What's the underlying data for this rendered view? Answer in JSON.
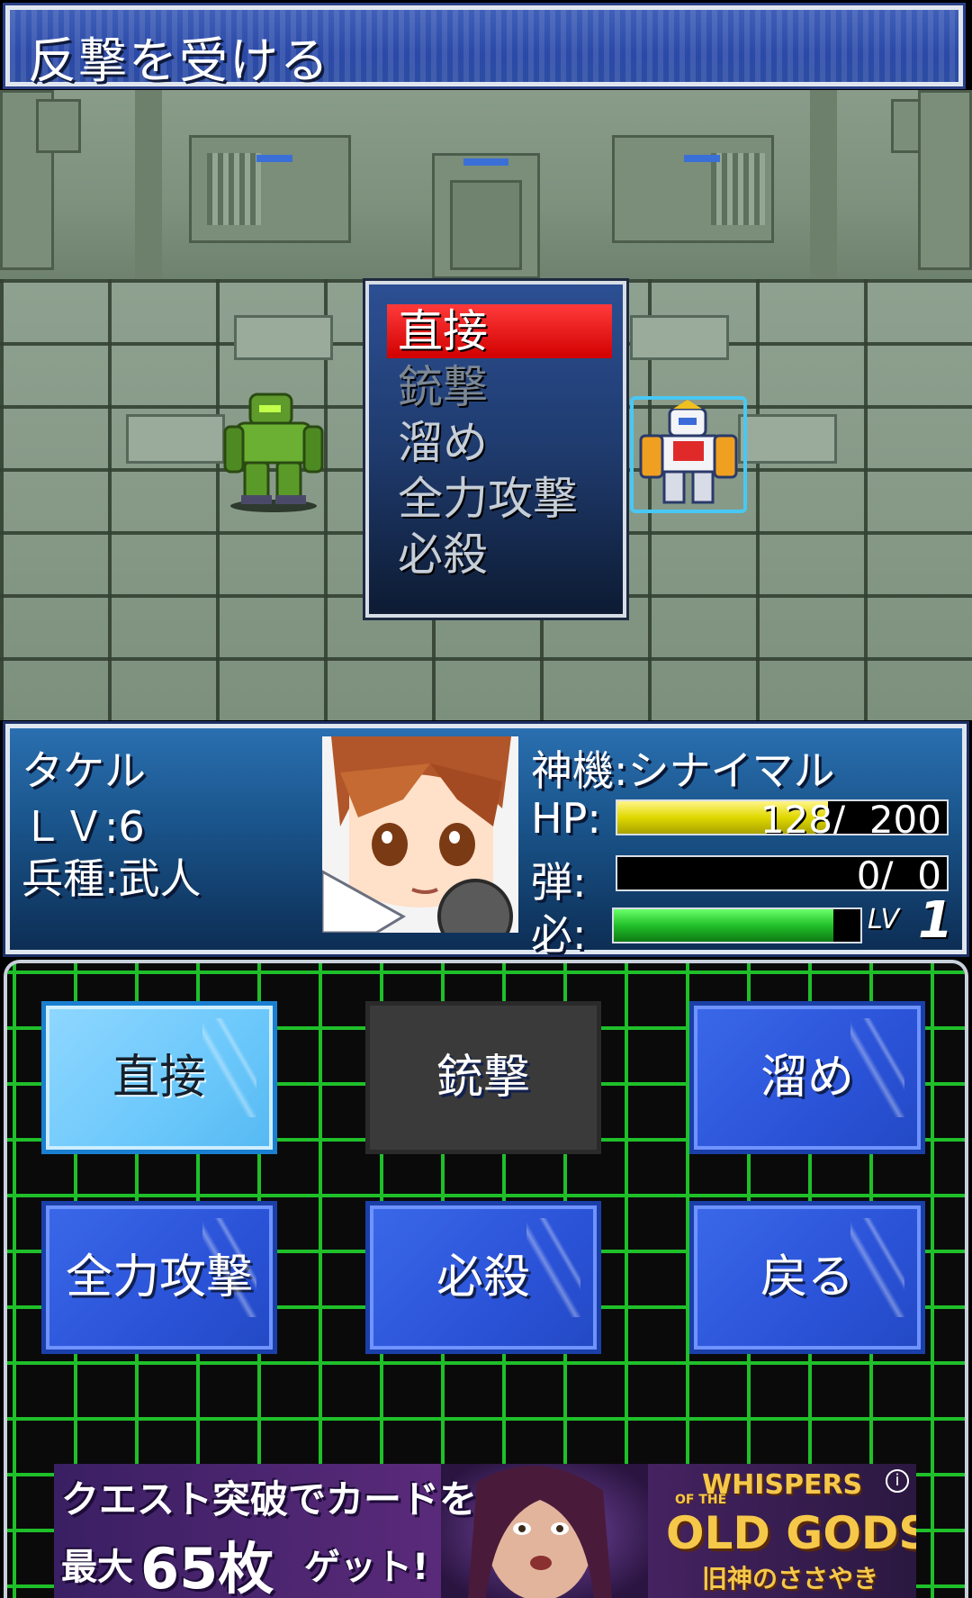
{
  "header": {
    "title": "反撃を受ける"
  },
  "battle_menu": {
    "items": [
      {
        "label": "直接",
        "state": "selected"
      },
      {
        "label": "銃撃",
        "state": "disabled"
      },
      {
        "label": "溜め",
        "state": "enabled"
      },
      {
        "label": "全力攻撃",
        "state": "enabled"
      },
      {
        "label": "必殺",
        "state": "enabled"
      }
    ]
  },
  "status": {
    "pilot_name": "タケル",
    "level": "ＬＶ:6",
    "class": "兵種:武人",
    "machine": "神機:シナイマル",
    "hp_label": "HP:",
    "hp_text": "128/  200",
    "hp_value": 128,
    "hp_max": 200,
    "ammo_label": "弾:",
    "ammo_text": "0/  0",
    "ammo_value": 0,
    "ammo_max": 0,
    "special_label": "必:",
    "special_fraction": 0.89,
    "special_level_label": "LV",
    "special_level": "1"
  },
  "commands": {
    "buttons": [
      {
        "label": "直接",
        "state": "active"
      },
      {
        "label": "銃撃",
        "state": "disabled"
      },
      {
        "label": "溜め",
        "state": "normal"
      },
      {
        "label": "全力攻撃",
        "state": "normal"
      },
      {
        "label": "必殺",
        "state": "normal"
      },
      {
        "label": "戻る",
        "state": "normal"
      }
    ]
  },
  "ad": {
    "line1": "クエスト突破でカードを",
    "line2_a": "最大",
    "line2_b": "65枚",
    "line2_c": "ゲット!",
    "logo_top": "WHISPERS",
    "logo_small": "OF THE",
    "logo_main": "OLD GODS",
    "logo_sub": "旧神のささやき",
    "info": "i"
  },
  "colors": {
    "menu_selected": "#e00000",
    "hp_bar": "#e8e000",
    "special_bar": "#22c02a",
    "grid": "#1fbf2a",
    "button_blue": "#2b53d8",
    "button_active": "#6cc8fb"
  }
}
